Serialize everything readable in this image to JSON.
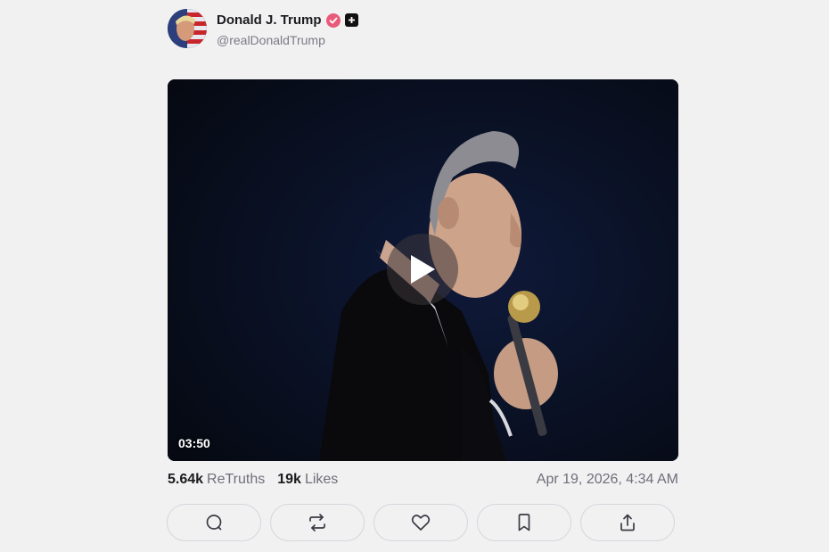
{
  "author": {
    "display_name": "Donald J. Trump",
    "handle": "@realDonaldTrump",
    "verified_color": "#e95a7a",
    "avatar_icon": "avatar-flag-portrait"
  },
  "video": {
    "duration": "03:50",
    "play_icon": "play-icon"
  },
  "stats": {
    "retruths_count": "5.64k",
    "retruths_label": "ReTruths",
    "likes_count": "19k",
    "likes_label": "Likes",
    "timestamp": "Apr 19, 2026, 4:34 AM"
  },
  "actions": [
    {
      "icon": "comment-icon"
    },
    {
      "icon": "retruth-icon"
    },
    {
      "icon": "heart-icon"
    },
    {
      "icon": "bookmark-icon"
    },
    {
      "icon": "share-icon"
    }
  ]
}
